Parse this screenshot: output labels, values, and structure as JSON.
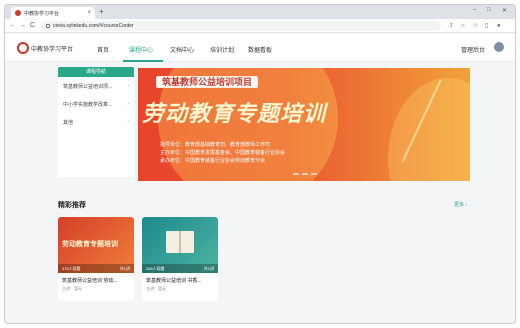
{
  "browser": {
    "tab_title": "中教协学习平台",
    "new_tab": "+",
    "url": "ceeia.sylinkedu.com/#/courseCenter",
    "window_controls": [
      "–",
      "□",
      "✕"
    ],
    "tab_close": "×",
    "nav_back": "←",
    "nav_forward": "→",
    "nav_reload": "C",
    "toolbar_icons": [
      "share-icon",
      "lock-icon",
      "star-icon",
      "sidepanel-icon",
      "profile-icon"
    ],
    "toolbar_glyphs": [
      "⇪",
      "⌂",
      "☆",
      "▯",
      "●"
    ]
  },
  "site": {
    "logo_text": "中教协学习平台",
    "nav": [
      {
        "label": "首页",
        "active": false
      },
      {
        "label": "课程中心",
        "active": true
      },
      {
        "label": "文档中心",
        "active": false
      },
      {
        "label": "培训计划",
        "active": false
      },
      {
        "label": "数据看板",
        "active": false
      }
    ],
    "admin": "管理后台",
    "accent": "#2aa88c"
  },
  "sidebar": {
    "header": "课程导航",
    "items": [
      {
        "label": "筑基教师公益培训项...",
        "chevron": "›"
      },
      {
        "label": "中小学实施教学改革...",
        "chevron": "›"
      },
      {
        "label": "其他",
        "chevron": "›"
      }
    ]
  },
  "banner": {
    "tag": "筑基教师公益培训项目",
    "title": "劳动教育专题培训",
    "lines": [
      "指导单位：教育部基础教育司、教育部教师工作司",
      "主办单位：中国教育发展基金会、中国教育装备行业协会",
      "承办单位：中国教育装备行业协会劳动教育分会"
    ]
  },
  "recommend": {
    "title": "精彩推荐",
    "more": "更多 ›",
    "cards": [
      {
        "thumb_title": "劳动教育专题培训",
        "views": "375人观看",
        "count": "共1讲",
        "name": "筑基教师公益培训 劳动...",
        "host": "主讲：暂无"
      },
      {
        "thumb_title": "",
        "views": "286人观看",
        "count": "共1讲",
        "name": "筑基教师公益培训 书香...",
        "host": "主讲：暂无"
      }
    ]
  },
  "colors": {
    "banner_red": "#e8442a",
    "banner_orange": "#f2a23a",
    "accent_green": "#2aa88c"
  }
}
